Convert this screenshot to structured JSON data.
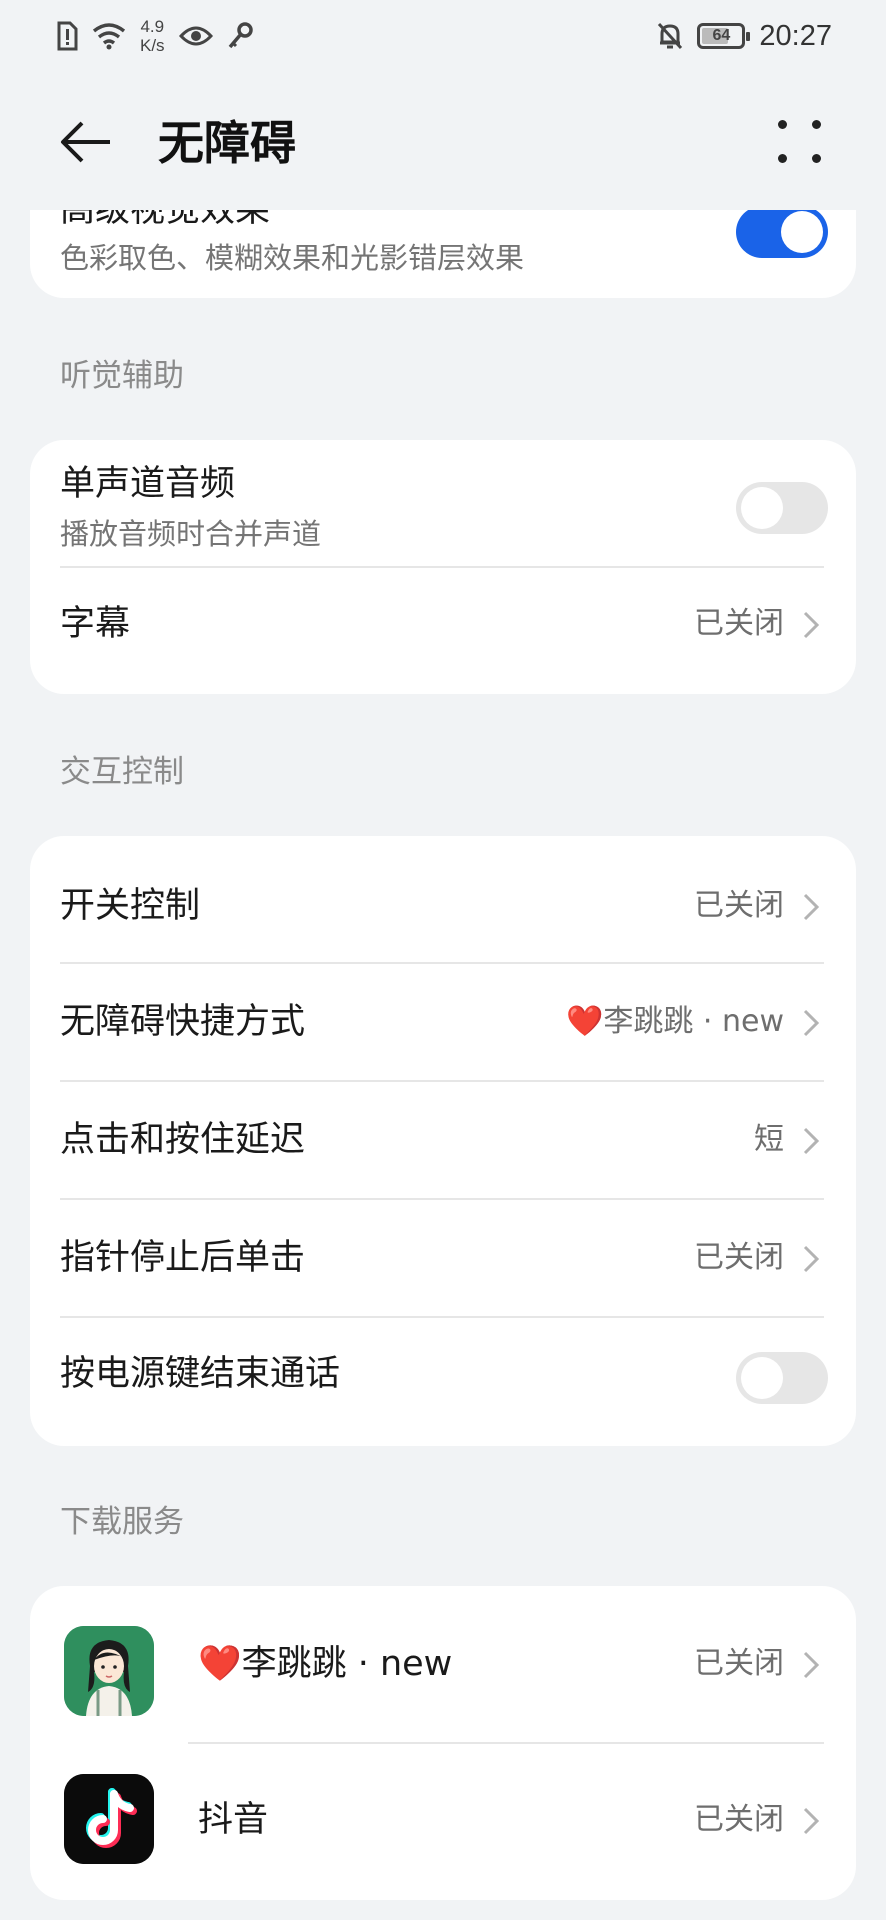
{
  "status_bar": {
    "net_speed_value": "4.9",
    "net_speed_unit": "K/s",
    "battery": "64",
    "time": "20:27"
  },
  "header": {
    "title": "无障碍"
  },
  "top_card": {
    "title": "高级视觉效果",
    "subtitle": "色彩取色、模糊效果和光影错层效果",
    "toggle_on": true
  },
  "sections": {
    "hearing": "听觉辅助",
    "interaction": "交互控制",
    "download": "下载服务"
  },
  "hearing": {
    "mono_audio": {
      "title": "单声道音频",
      "subtitle": "播放音频时合并声道",
      "toggle_on": false
    },
    "captions": {
      "title": "字幕",
      "value": "已关闭"
    }
  },
  "interaction": {
    "switch_control": {
      "title": "开关控制",
      "value": "已关闭"
    },
    "shortcut": {
      "title": "无障碍快捷方式",
      "value_heart": "❤️",
      "value": "李跳跳 · new"
    },
    "touch_delay": {
      "title": "点击和按住延迟",
      "value": "短"
    },
    "dwell_click": {
      "title": "指针停止后单击",
      "value": "已关闭"
    },
    "power_end_call": {
      "title": "按电源键结束通话",
      "toggle_on": false
    }
  },
  "download": {
    "items": [
      {
        "heart": "❤️",
        "name": "李跳跳 · new",
        "value": "已关闭",
        "icon": "cartoon-girl-avatar-icon"
      },
      {
        "name": "抖音",
        "value": "已关闭",
        "icon": "tiktok-icon"
      }
    ]
  }
}
